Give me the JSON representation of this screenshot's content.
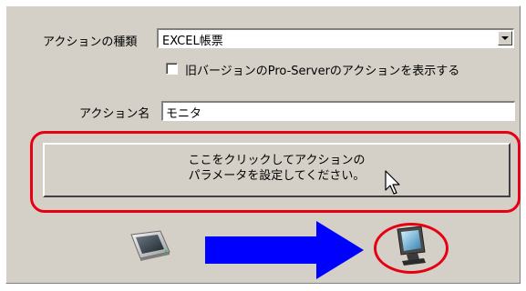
{
  "action_type": {
    "label": "アクションの種類",
    "value": "EXCEL帳票"
  },
  "legacy_checkbox": {
    "label": "旧バージョンのPro-Serverのアクションを表示する",
    "checked": false
  },
  "action_name": {
    "label": "アクション名",
    "value": "モニタ"
  },
  "parameter_button": {
    "line1": "ここをクリックしてアクションの",
    "line2": "パラメータを設定してください。"
  },
  "icons": {
    "source": "display-panel-icon",
    "arrow": "right-arrow-icon",
    "target": "monitor-icon"
  },
  "colors": {
    "highlight": "#e60012",
    "arrow": "#0000ff",
    "window": "#d4d0c8"
  }
}
